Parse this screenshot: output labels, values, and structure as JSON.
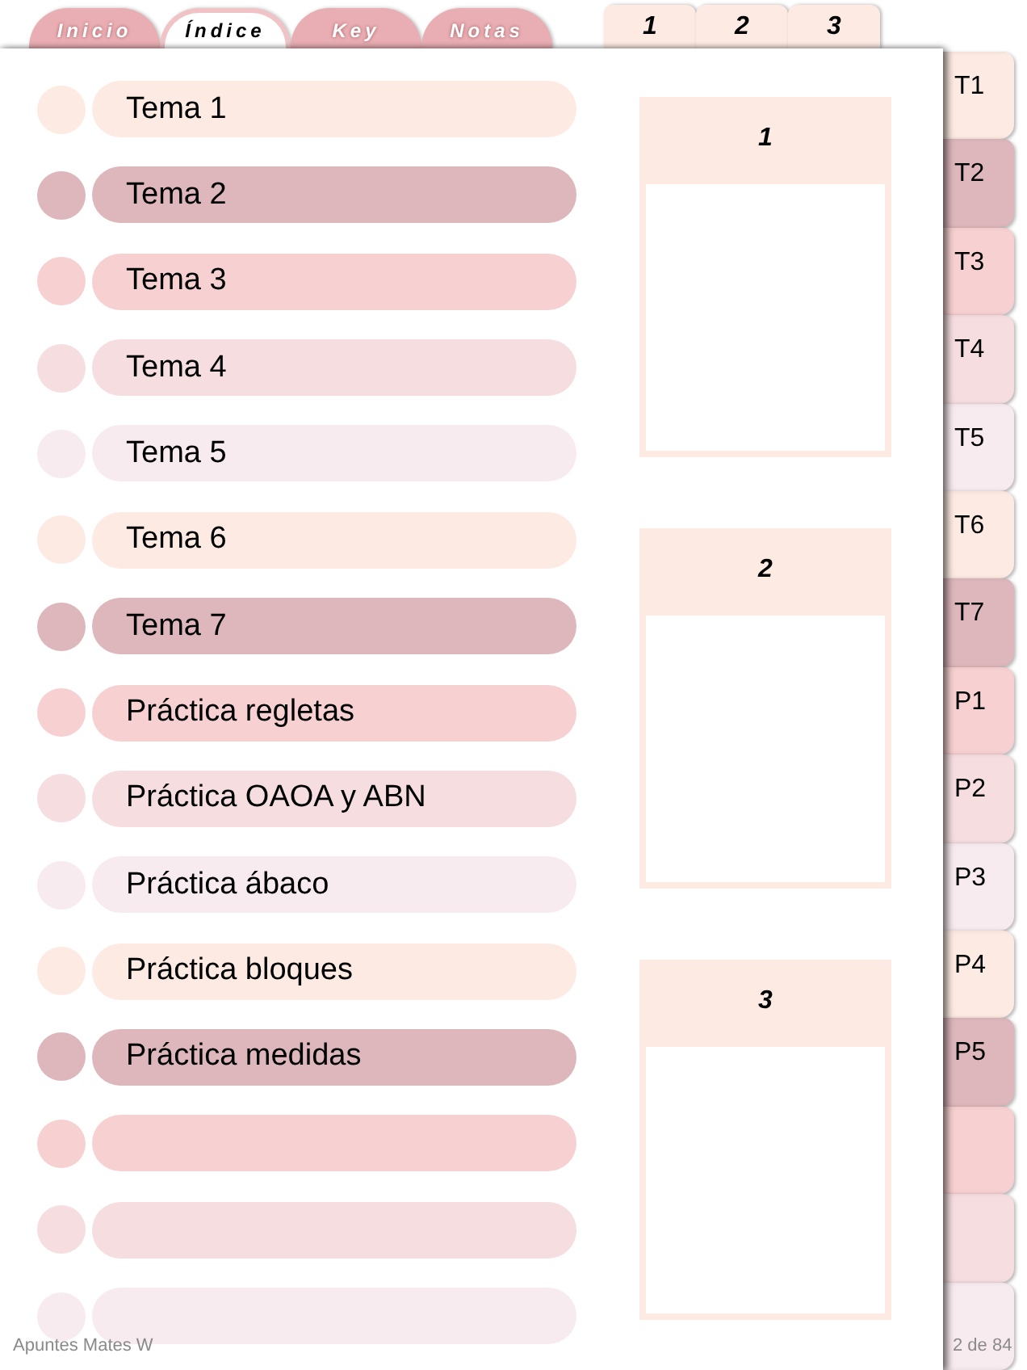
{
  "top_tabs": [
    {
      "label": "Inicio",
      "selected": false
    },
    {
      "label": "Índice",
      "selected": true
    },
    {
      "label": "Key",
      "selected": false
    },
    {
      "label": "Notas",
      "selected": false
    }
  ],
  "section_tabs": [
    {
      "label": "1"
    },
    {
      "label": "2"
    },
    {
      "label": "3"
    }
  ],
  "index_rows": [
    {
      "label": "Tema 1",
      "color": "#fdebe3"
    },
    {
      "label": "Tema 2",
      "color": "#ddb7bc"
    },
    {
      "label": "Tema 3",
      "color": "#f7d1d1"
    },
    {
      "label": "Tema 4",
      "color": "#f5dde0"
    },
    {
      "label": "Tema 5",
      "color": "#f8ebef"
    },
    {
      "label": "Tema 6",
      "color": "#fdebe3"
    },
    {
      "label": "Tema 7",
      "color": "#ddb7bc"
    },
    {
      "label": "Práctica regletas",
      "color": "#f7d1d1"
    },
    {
      "label": "Práctica OAOA y ABN",
      "color": "#f5dde0"
    },
    {
      "label": "Práctica ábaco",
      "color": "#f8ebef"
    },
    {
      "label": "Práctica bloques",
      "color": "#fdebe3"
    },
    {
      "label": "Práctica medidas",
      "color": "#ddb7bc"
    },
    {
      "color": "#f7d1d1"
    },
    {
      "color": "#f5dde0"
    },
    {
      "color": "#f8ebef"
    }
  ],
  "boxes": [
    {
      "title": "1"
    },
    {
      "title": "2"
    },
    {
      "title": "3"
    }
  ],
  "side_tabs": [
    {
      "label": "T1",
      "color": "#fdebe3"
    },
    {
      "label": "T2",
      "color": "#ddb7bc"
    },
    {
      "label": "T3",
      "color": "#f7d1d1"
    },
    {
      "label": "T4",
      "color": "#f5dde0"
    },
    {
      "label": "T5",
      "color": "#f8ebef"
    },
    {
      "label": "T6",
      "color": "#fdebe3"
    },
    {
      "label": "T7",
      "color": "#ddb7bc"
    },
    {
      "label": "P1",
      "color": "#f7d1d1"
    },
    {
      "label": "P2",
      "color": "#f5dde0"
    },
    {
      "label": "P3",
      "color": "#f8ebef"
    },
    {
      "label": "P4",
      "color": "#fdebe3"
    },
    {
      "label": "P5",
      "color": "#ddb7bc"
    },
    {
      "color": "#f7d1d1"
    },
    {
      "color": "#f5dde0"
    },
    {
      "color": "#f8ebef"
    }
  ],
  "footer": {
    "document": "Apuntes Mates W",
    "page": "2 de 84"
  }
}
